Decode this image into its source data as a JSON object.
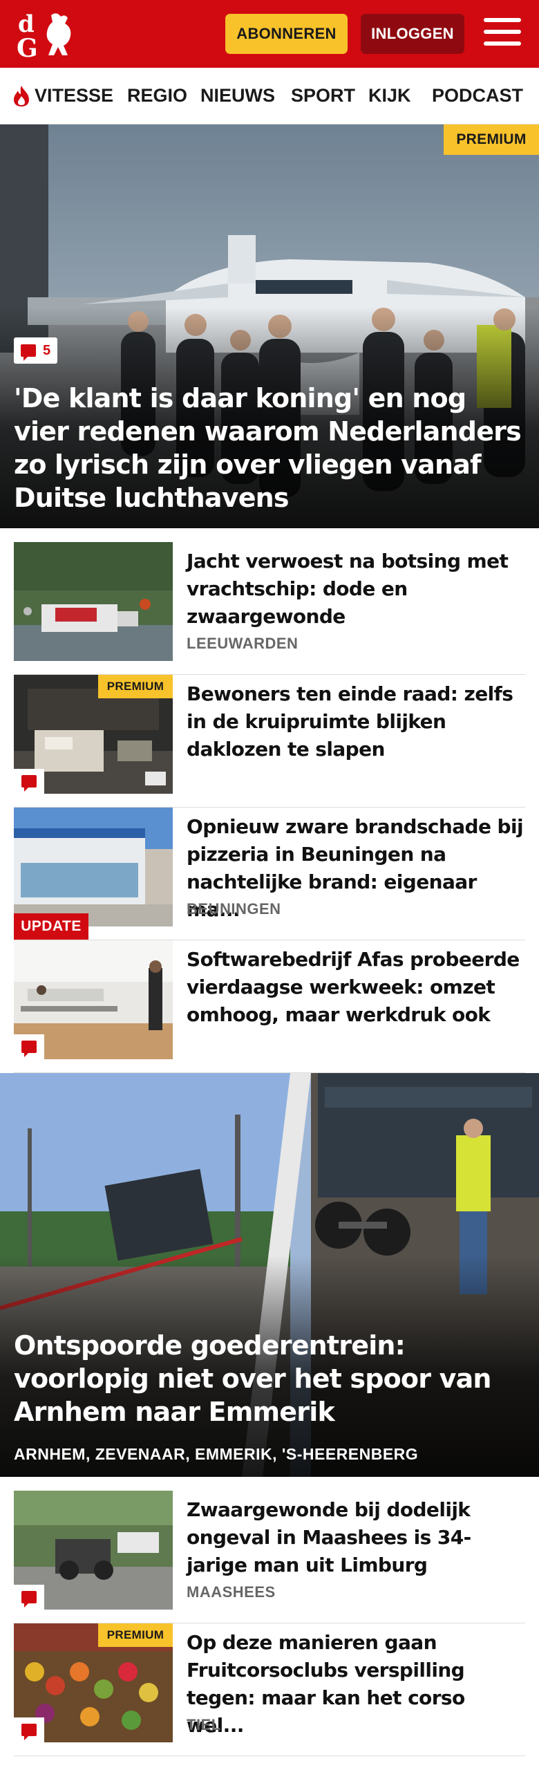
{
  "header": {
    "logo_text": "dG",
    "subscribe_label": "ABONNEREN",
    "login_label": "INLOGGEN",
    "brand_color": "#d10a11",
    "accent_color": "#f8c22b"
  },
  "nav": {
    "items": [
      {
        "label": "VITESSE",
        "icon": "flame-icon"
      },
      {
        "label": "REGIO"
      },
      {
        "label": "NIEUWS"
      },
      {
        "label": "SPORT"
      },
      {
        "label": "KIJK"
      },
      {
        "label": "PODCAST"
      }
    ]
  },
  "hero": {
    "badge": "PREMIUM",
    "comments": "5",
    "title": "'De klant is daar koning' en nog vier redenen waarom Nederlanders zo lyrisch zijn over vliegen vanaf Duitse luchthavens"
  },
  "articles": [
    {
      "title": "Jacht verwoest na botsing met vrachtschip: dode en zwaargewonde",
      "location": "LEEUWARDEN"
    },
    {
      "title": "Bewoners ten einde raad: zelfs in de kruipruimte blijken daklozen te slapen",
      "badge": "PREMIUM"
    },
    {
      "title": "Opnieuw zware brandschade bij pizzeria in Beuningen na nachtelijke brand: eigenaar ma...",
      "location": "BEUNINGEN",
      "badge": "UPDATE"
    },
    {
      "title": "Softwarebedrijf Afas probeerde vierdaagse werkweek: omzet omhoog, maar werkdruk ook"
    },
    {
      "title": "Zwaargewonde bij dodelijk ongeval in Maashees is 34-jarige man uit Limburg",
      "location": "MAASHEES"
    },
    {
      "title": "Op deze manieren gaan Fruitcorsoclubs verspilling tegen: maar kan het corso wel...",
      "location": "TIEL",
      "badge": "PREMIUM"
    }
  ],
  "hero2": {
    "title": "Ontspoorde goederentrein: voorlopig niet over het spoor van Arnhem naar Emmerik",
    "locations": "ARNHEM, ZEVENAAR, EMMERIK, 'S-HEERENBERG"
  }
}
